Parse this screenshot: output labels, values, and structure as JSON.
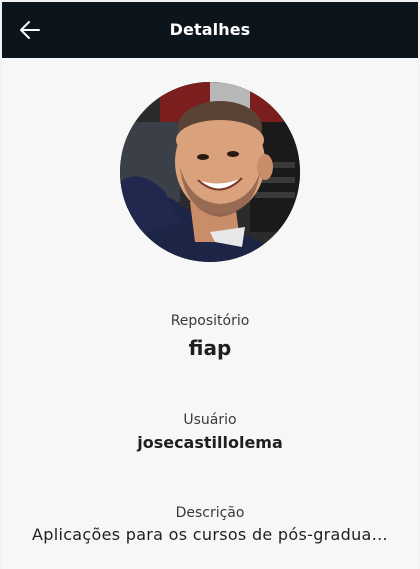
{
  "appbar": {
    "title": "Detalhes",
    "back_icon": "arrow-left-icon"
  },
  "profile": {
    "avatar_icon": "user-avatar-photo"
  },
  "fields": {
    "repository": {
      "label": "Repositório",
      "value": "fiap"
    },
    "user": {
      "label": "Usuário",
      "value": "josecastillolema"
    },
    "description": {
      "label": "Descrição",
      "value": "Aplicações para os cursos de pós-graduação"
    }
  },
  "colors": {
    "appbar_bg": "#0c141c",
    "page_bg": "#f7f7f7",
    "title_text": "#ffffff",
    "body_text": "#1f1f1f"
  }
}
